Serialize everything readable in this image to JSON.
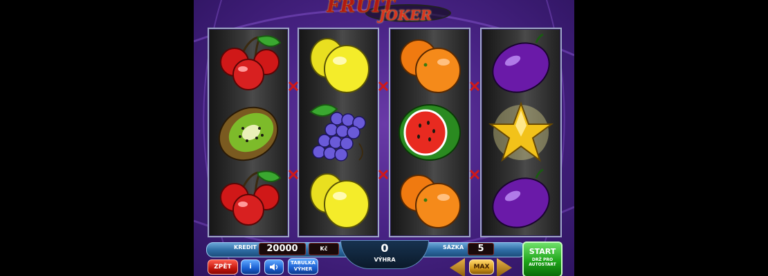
{
  "game": {
    "title_word1": "FRUIT",
    "title_word2": "JOKER"
  },
  "reels": [
    {
      "symbols": [
        "cherries-icon",
        "kiwi-icon",
        "cherries-icon"
      ]
    },
    {
      "symbols": [
        "lemon-icon",
        "grapes-icon",
        "lemon-icon"
      ]
    },
    {
      "symbols": [
        "orange-icon",
        "watermelon-icon",
        "orange-icon"
      ]
    },
    {
      "symbols": [
        "plum-icon",
        "star-icon",
        "plum-icon"
      ]
    }
  ],
  "panel": {
    "credit_label": "KREDIT",
    "credit_value": "20000",
    "currency": "Kč",
    "win_value": "0",
    "win_label": "VÝHRA",
    "bet_label": "SÁZKA",
    "bet_value": "5",
    "back_button": "ZPĚT",
    "info_button": "i",
    "paytable_button_line1": "TABULKA",
    "paytable_button_line2": "VÝHER",
    "max_button": "MAX",
    "start_button": "START",
    "autostart_hint_line1": "DRŽ PRO",
    "autostart_hint_line2": "AUTOSTART"
  },
  "colors": {
    "background": "#4a2487",
    "reel_border": "#9fa7c8",
    "start_green": "#1fa51a",
    "marker_red": "#d01818"
  }
}
